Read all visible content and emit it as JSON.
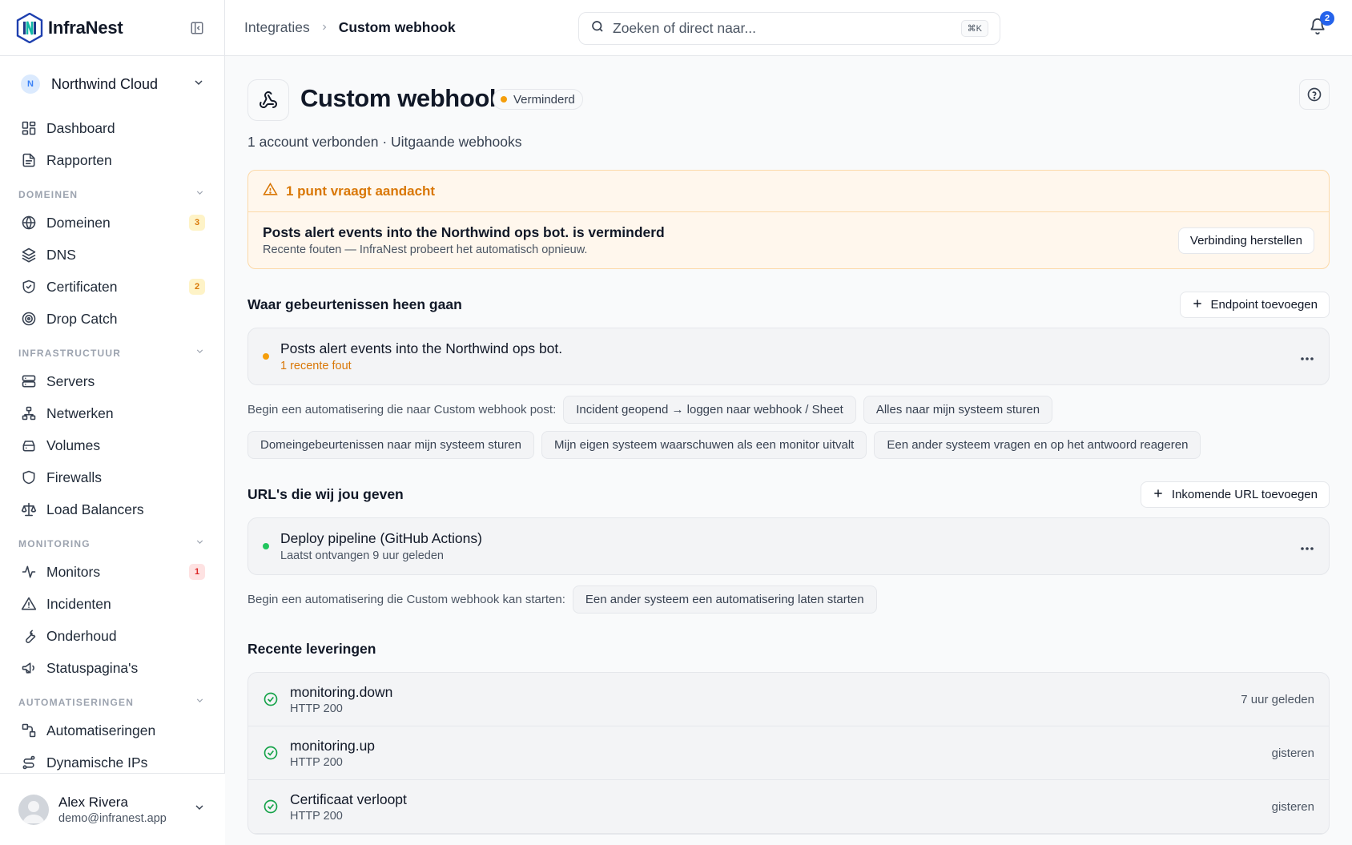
{
  "brand": {
    "name": "InfraNest"
  },
  "org": {
    "initial": "N",
    "name": "Northwind Cloud"
  },
  "nav": {
    "top": [
      {
        "label": "Dashboard",
        "icon": "dashboard-icon"
      },
      {
        "label": "Rapporten",
        "icon": "report-icon"
      }
    ],
    "sections": [
      {
        "title": "DOMEINEN",
        "items": [
          {
            "label": "Domeinen",
            "icon": "globe-icon",
            "count": "3",
            "count_color": "amber"
          },
          {
            "label": "DNS",
            "icon": "layers-icon"
          },
          {
            "label": "Certificaten",
            "icon": "shield-check-icon",
            "count": "2",
            "count_color": "amber"
          },
          {
            "label": "Drop Catch",
            "icon": "target-icon"
          }
        ]
      },
      {
        "title": "INFRASTRUCTUUR",
        "items": [
          {
            "label": "Servers",
            "icon": "server-icon"
          },
          {
            "label": "Netwerken",
            "icon": "network-icon"
          },
          {
            "label": "Volumes",
            "icon": "hard-drive-icon"
          },
          {
            "label": "Firewalls",
            "icon": "shield-icon"
          },
          {
            "label": "Load Balancers",
            "icon": "scale-icon"
          }
        ]
      },
      {
        "title": "MONITORING",
        "items": [
          {
            "label": "Monitors",
            "icon": "activity-icon",
            "count": "1",
            "count_color": "red"
          },
          {
            "label": "Incidenten",
            "icon": "warning-icon"
          },
          {
            "label": "Onderhoud",
            "icon": "wrench-icon"
          },
          {
            "label": "Statuspagina's",
            "icon": "megaphone-icon"
          }
        ]
      },
      {
        "title": "AUTOMATISERINGEN",
        "items": [
          {
            "label": "Automatiseringen",
            "icon": "workflow-icon"
          },
          {
            "label": "Dynamische IPs",
            "icon": "route-icon"
          }
        ]
      }
    ]
  },
  "user": {
    "name": "Alex Rivera",
    "email": "demo@infranest.app"
  },
  "breadcrumb": {
    "parent": "Integraties",
    "current": "Custom webhook"
  },
  "search": {
    "placeholder": "Zoeken of direct naar...",
    "shortcut": "⌘K"
  },
  "notifications": {
    "count": "2"
  },
  "header": {
    "title": "Custom webhook",
    "status": "Verminderd",
    "subtitle": "1 account verbonden · Uitgaande webhooks"
  },
  "alert": {
    "heading": "1 punt vraagt aandacht",
    "title": "Posts alert events into the Northwind ops bot. is verminderd",
    "description": "Recente fouten — InfraNest probeert het automatisch opnieuw.",
    "action": "Verbinding herstellen"
  },
  "outgoing": {
    "title": "Waar gebeurtenissen heen gaan",
    "add_label": "Endpoint toevoegen",
    "endpoint": {
      "title": "Posts alert events into the Northwind ops bot.",
      "sub": "1 recente fout"
    },
    "lead": "Begin een automatisering die naar Custom webhook post:",
    "chips": [
      "Incident geopend → loggen naar webhook / Sheet",
      "Alles naar mijn systeem sturen",
      "Domeingebeurtenissen naar mijn systeem sturen",
      "Mijn eigen systeem waarschuwen als een monitor uitvalt",
      "Een ander systeem vragen en op het antwoord reageren"
    ]
  },
  "incoming": {
    "title": "URL's die wij jou geven",
    "add_label": "Inkomende URL toevoegen",
    "endpoint": {
      "title": "Deploy pipeline (GitHub Actions)",
      "sub": "Laatst ontvangen 9 uur geleden"
    },
    "lead": "Begin een automatisering die Custom webhook kan starten:",
    "chips": [
      "Een ander systeem een automatisering laten starten"
    ]
  },
  "deliveries": {
    "title": "Recente leveringen",
    "rows": [
      {
        "event": "monitoring.down",
        "code": "HTTP 200",
        "time": "7 uur geleden"
      },
      {
        "event": "monitoring.up",
        "code": "HTTP 200",
        "time": "gisteren"
      },
      {
        "event": "Certificaat verloopt",
        "code": "HTTP 200",
        "time": "gisteren"
      }
    ]
  },
  "colors": {
    "accent": "#2563eb",
    "warning": "#f59e0b",
    "success": "#22c55e",
    "danger": "#dc2626"
  }
}
